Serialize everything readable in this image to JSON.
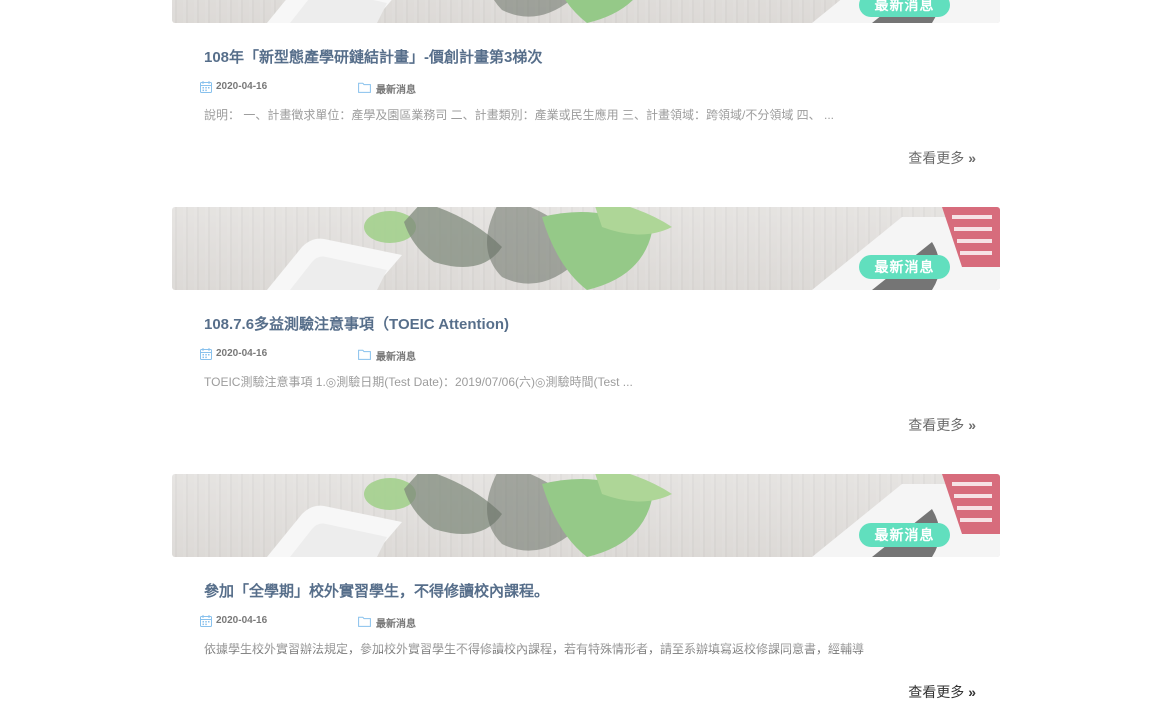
{
  "posts": [
    {
      "badge": "最新消息",
      "title": "108年「新型態產學研鏈結計畫」-價創計畫第3梯次",
      "date": "2020-04-16",
      "category": "最新消息",
      "excerpt": "說明： 一、計畫徵求單位：產學及園區業務司 二、計畫類別：產業或民生應用 三、計畫領域：跨領域/不分領域 四、 ...",
      "more": "查看更多"
    },
    {
      "badge": "最新消息",
      "title": "108.7.6多益測驗注意事項（TOEIC Attention)",
      "date": "2020-04-16",
      "category": "最新消息",
      "excerpt": "TOEIC測驗注意事項 1.◎測驗日期(Test Date)：2019/07/06(六)◎測驗時間(Test ...",
      "more": "查看更多"
    },
    {
      "badge": "最新消息",
      "title": "參加「全學期」校外實習學生，不得修讀校內課程。",
      "date": "2020-04-16",
      "category": "最新消息",
      "excerpt": "依據學生校外實習辦法規定，參加校外實習學生不得修讀校內課程，若有特殊情形者，請至系辦填寫返校修課同意書，經輔導",
      "more": "查看更多"
    }
  ],
  "colors": {
    "badge": "#25d3a6",
    "title": "#16365d",
    "excerpt": "#777777"
  },
  "icons": {
    "date": "calendar-icon",
    "category": "folder-icon",
    "more": "double-chevron-right-icon"
  }
}
